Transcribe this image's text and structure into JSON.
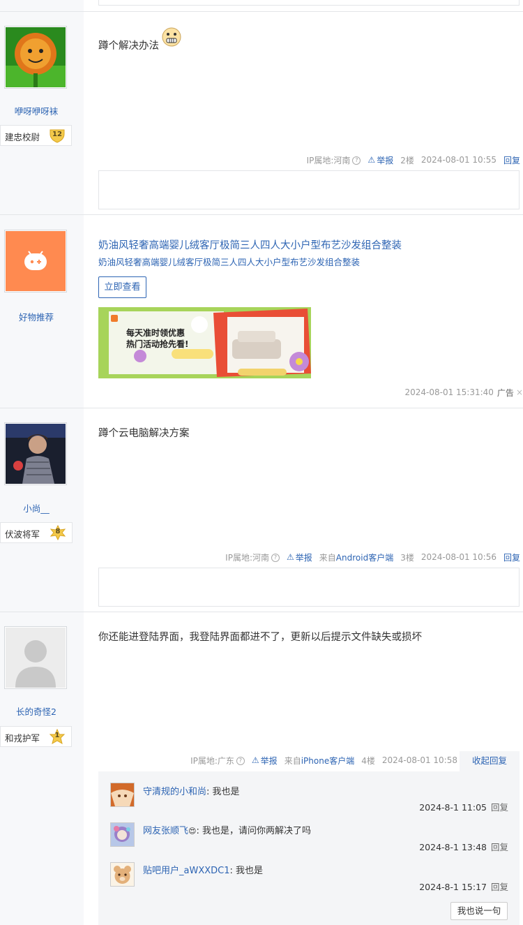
{
  "posts": [
    {
      "username": "咿呀咿呀袜",
      "badge_title": "建忠校尉",
      "badge_level": "12",
      "content": "蹲个解决办法",
      "ip": "IP属地:河南",
      "report": "举报",
      "floor": "2楼",
      "time": "2024-08-01 10:55",
      "reply": "回复"
    },
    {
      "username": "小尚__",
      "badge_title": "伏波将军",
      "badge_level": "8",
      "content": "蹲个云电脑解决方案",
      "ip": "IP属地:河南",
      "report": "举报",
      "source": "来自Android客户端",
      "floor": "3楼",
      "time": "2024-08-01 10:56",
      "reply": "回复"
    },
    {
      "username": "长的奇怪2",
      "badge_title": "和戎护军",
      "badge_level": "1",
      "content": "你还能进登陆界面，我登陆界面都进不了，更新以后提示文件缺失或损坏",
      "ip": "IP属地:广东",
      "report": "举报",
      "source": "来自iPhone客户端",
      "floor": "4楼",
      "time": "2024-08-01 10:58",
      "collapse": "收起回复",
      "sub_replies": [
        {
          "user": "守清规的小和尚",
          "text": ": 我也是",
          "time": "2024-8-1 11:05",
          "reply": "回复"
        },
        {
          "user": "网友张顺飞",
          "text": ": 我也是，请问你两解决了吗",
          "time": "2024-8-1 13:48",
          "reply": "回复"
        },
        {
          "user": "贴吧用户_aWXXDC1",
          "text": ": 我也是",
          "time": "2024-8-1 15:17",
          "reply": "回复"
        }
      ],
      "say_button": "我也说一句"
    }
  ],
  "ad": {
    "name": "好物推荐",
    "title": "奶油风轻奢高端婴儿绒客厅极简三人四人大小户型布艺沙发组合整装",
    "subtitle": "奶油风轻奢高端婴儿绒客厅极简三人四人大小户型布艺沙发组合整装",
    "button": "立即查看",
    "banner_line1": "每天准时领优惠",
    "banner_line2": "热门活动抢先看!",
    "time": "2024-08-01 15:31:40",
    "label": "广告",
    "close": "×"
  },
  "colors": {
    "link": "#2d64b3",
    "leftcol": "#f7f8fa",
    "ad_orange": "#ff8a50"
  }
}
